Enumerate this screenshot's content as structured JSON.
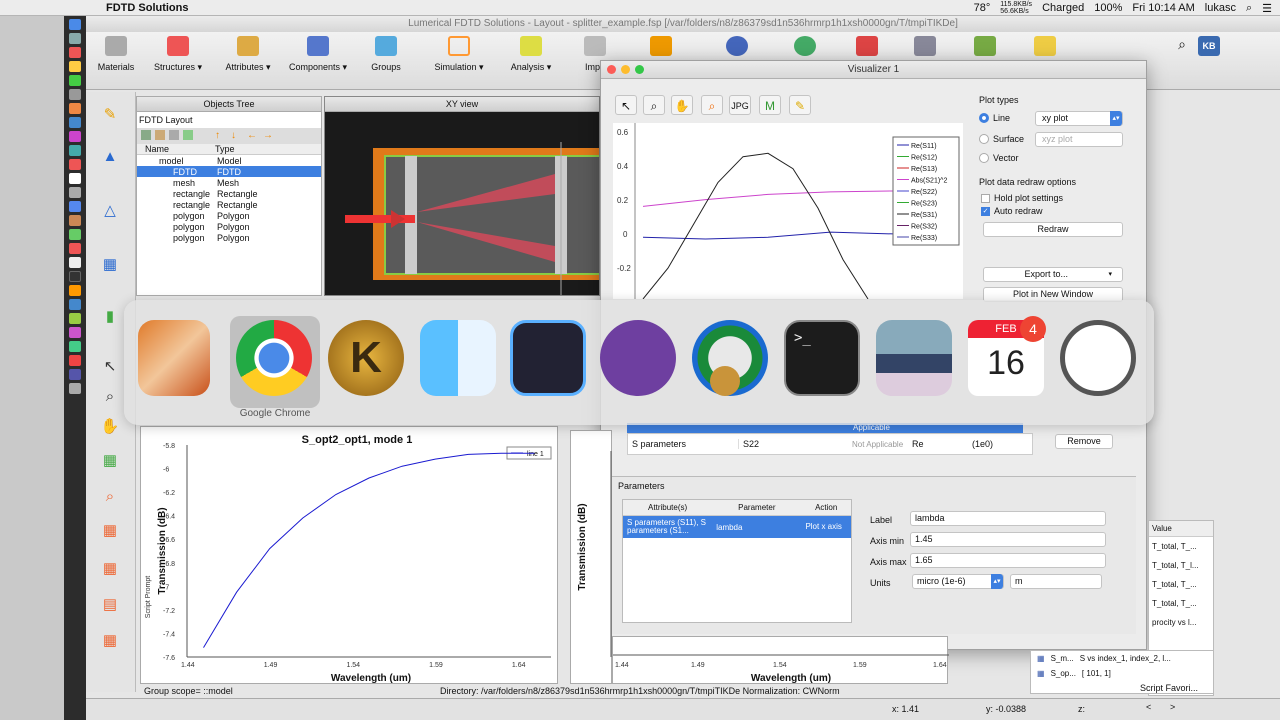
{
  "menubar": {
    "app_name": "FDTD Solutions",
    "status_items": [
      "78°",
      "115.8KB/s",
      "56.6KB/s",
      "Charged",
      "100%",
      "Fri 10:14 AM",
      "lukasc"
    ]
  },
  "window_title": "Lumerical FDTD Solutions - Layout - splitter_example.fsp [/var/folders/n8/z86379sd1n536hrmrp1h1xsh0000gn/T/tmpiTIKDe]",
  "ribbon": [
    {
      "label": "Materials"
    },
    {
      "label": "Structures"
    },
    {
      "label": "Attributes"
    },
    {
      "label": "Components"
    },
    {
      "label": "Groups"
    },
    {
      "label": "Simulation"
    },
    {
      "label": "Analysis"
    },
    {
      "label": "Impo"
    }
  ],
  "objects_tree": {
    "title": "Objects Tree",
    "layout_label": "FDTD Layout",
    "col_name": "Name",
    "col_type": "Type",
    "rows": [
      {
        "name": "model",
        "type": "Model"
      },
      {
        "name": "FDTD",
        "type": "FDTD"
      },
      {
        "name": "mesh",
        "type": "Mesh"
      },
      {
        "name": "rectangle",
        "type": "Rectangle"
      },
      {
        "name": "rectangle",
        "type": "Rectangle"
      },
      {
        "name": "polygon",
        "type": "Polygon"
      },
      {
        "name": "polygon",
        "type": "Polygon"
      },
      {
        "name": "polygon",
        "type": "Polygon"
      }
    ]
  },
  "xy_view": {
    "title": "XY view"
  },
  "visualizer": {
    "title": "Visualizer 1",
    "legend": [
      "Re(S11)",
      "Re(S12)",
      "Re(S13)",
      "Abs(S21)^2",
      "Re(S22)",
      "Re(S23)",
      "Re(S31)",
      "Re(S32)",
      "Re(S33)"
    ],
    "y_ticks": [
      "0.6",
      "0.4",
      "0.2",
      "0",
      "-0.2"
    ],
    "plot_types_label": "Plot types",
    "line_label": "Line",
    "line_select": "xy plot",
    "surface_label": "Surface",
    "surface_select": "xyz plot",
    "vector_label": "Vector",
    "redraw_options_label": "Plot data redraw options",
    "hold_label": "Hold plot settings",
    "auto_label": "Auto redraw",
    "redraw_button": "Redraw",
    "export_button": "Export to...",
    "new_window_button": "Plot in New Window",
    "remove_button": "Remove",
    "table_row": {
      "c1": "S parameters",
      "c2": "S22",
      "c3": "Not Applicable",
      "c4": "Re",
      "c5": "(1e0)"
    },
    "table_top_text": "Applicable",
    "params_label": "Parameters",
    "params_cols": [
      "Attribute(s)",
      "Parameter",
      "Action"
    ],
    "params_row": {
      "attr": "S parameters (S11), S parameters (S1...",
      "param": "lambda",
      "action": "Plot x axis"
    },
    "label_field_label": "Label",
    "label_value": "lambda",
    "axis_min_label": "Axis min",
    "axis_min_value": "1.45",
    "axis_max_label": "Axis max",
    "axis_max_value": "1.65",
    "units_label": "Units",
    "units_value": "micro (1e-6)",
    "units_unit": "m"
  },
  "switcher": {
    "selected_label": "Google Chrome",
    "calendar_month": "FEB",
    "calendar_day": "16",
    "calendar_badge": "4",
    "terminal_prompt": ">_"
  },
  "plot_left": {
    "title": "S_opt2_opt1, mode 1",
    "legend": "line 1",
    "ylabel": "Transmission (dB)",
    "xlabel": "Wavelength (um)",
    "side_label": "Script Prompt"
  },
  "plot_right": {
    "ylabel": "Transmission (dB)",
    "xlabel": "Wavelength (um)"
  },
  "right_list": {
    "header": "Value",
    "items": [
      "T_total, T_...",
      "T_total, T_l...",
      "T_total, T_...",
      "T_total, T_...",
      "procity vs l...",
      "S vs index_1, index_2, l...",
      "[ 101, 1]"
    ],
    "left_items": [
      "S_m...",
      "S_op..."
    ],
    "footer": "Script Favori..."
  },
  "status": {
    "group_scope": "Group scope= ::model",
    "directory": "Directory: /var/folders/n8/z86379sd1n536hrmrp1h1xsh0000gn/T/tmpiTIKDe   Normalization: CWNorm",
    "x_readout": "x: 1.41",
    "y_readout": "y: -0.0388",
    "z_readout": "z:"
  },
  "chart_data": [
    {
      "type": "line",
      "title": "S_opt2_opt1, mode 1",
      "xlabel": "Wavelength (um)",
      "ylabel": "Transmission (dB)",
      "x_ticks": [
        "1.44",
        "1.49",
        "1.54",
        "1.59",
        "1.64"
      ],
      "y_ticks": [
        "-5.8",
        "-6",
        "-6.2",
        "-6.4",
        "-6.6",
        "-6.8",
        "-7",
        "-7.2",
        "-7.4",
        "-7.6"
      ],
      "xlim": [
        1.44,
        1.66
      ],
      "ylim": [
        -7.6,
        -5.8
      ],
      "series": [
        {
          "name": "line 1",
          "x": [
            1.45,
            1.47,
            1.49,
            1.51,
            1.53,
            1.55,
            1.57,
            1.59,
            1.61,
            1.63,
            1.65
          ],
          "y": [
            -7.52,
            -7.05,
            -6.68,
            -6.42,
            -6.22,
            -6.08,
            -5.98,
            -5.92,
            -5.88,
            -5.87,
            -5.87
          ]
        }
      ]
    },
    {
      "type": "line",
      "xlabel": "",
      "ylabel": "",
      "y_ticks": [
        "0.6",
        "0.4",
        "0.2",
        "0",
        "-0.2"
      ],
      "xlim": [
        1.45,
        1.65
      ],
      "ylim": [
        -0.38,
        0.6
      ],
      "series": [
        {
          "name": "Re(S11)",
          "color": "#2222aa",
          "x": [
            1.45,
            1.5,
            1.55,
            1.6,
            1.65
          ],
          "y": [
            -0.02,
            -0.03,
            -0.02,
            0.01,
            0.0
          ]
        },
        {
          "name": "Abs(S21)^2",
          "color": "#cc44cc",
          "x": [
            1.45,
            1.5,
            1.55,
            1.6,
            1.65
          ],
          "y": [
            0.16,
            0.2,
            0.23,
            0.245,
            0.25
          ]
        },
        {
          "name": "Re(S31)",
          "color": "#222222",
          "x": [
            1.45,
            1.47,
            1.49,
            1.51,
            1.53,
            1.55,
            1.57,
            1.59,
            1.61,
            1.63
          ],
          "y": [
            -0.38,
            -0.2,
            0.05,
            0.3,
            0.45,
            0.47,
            0.38,
            0.15,
            -0.15,
            -0.38
          ]
        }
      ]
    }
  ]
}
